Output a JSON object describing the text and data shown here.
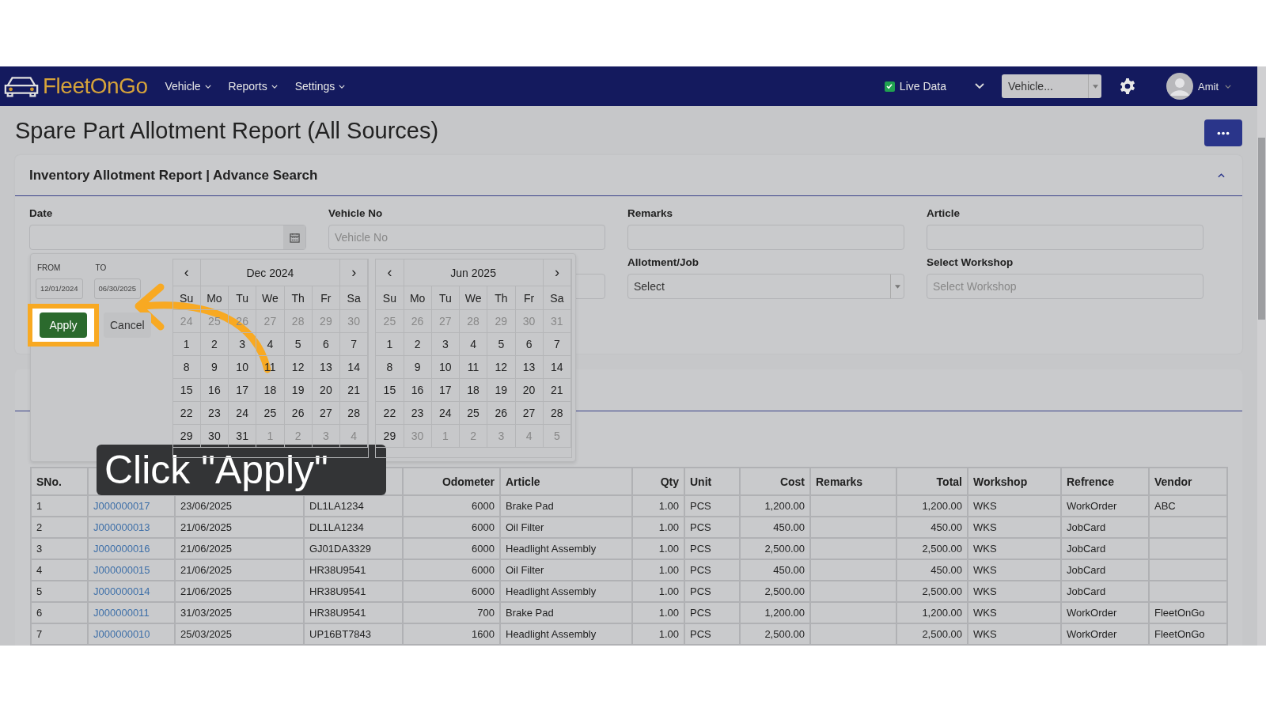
{
  "navbar": {
    "logo": "FleetOnGo",
    "menus": [
      {
        "label": "Vehicle"
      },
      {
        "label": "Reports"
      },
      {
        "label": "Settings"
      }
    ],
    "live_data": {
      "label": "Live Data",
      "checked": true
    },
    "vehicle_select": {
      "value": "Vehicle..."
    },
    "user": {
      "name": "Amit"
    }
  },
  "page_title": "Spare Part Allotment Report (All Sources)",
  "search_panel": {
    "title": "Inventory Allotment Report | Advance Search",
    "expanded": true,
    "fields": [
      {
        "label": "Date",
        "kind": "date"
      },
      {
        "label": "Vehicle No",
        "kind": "text",
        "placeholder": "Vehicle No"
      },
      {
        "label": "Remarks",
        "kind": "text"
      },
      {
        "label": "Article",
        "kind": "text"
      },
      {
        "label": "Allotment/Job",
        "kind": "select",
        "value": "Select"
      },
      {
        "label": "Select Workshop",
        "kind": "text",
        "placeholder": "Select Workshop"
      }
    ]
  },
  "date_picker": {
    "from_label": "FROM",
    "from_value": "12/01/2024",
    "to_label": "TO",
    "to_value": "06/30/2025",
    "apply": "Apply",
    "cancel": "Cancel",
    "calendars": [
      {
        "prev": "‹",
        "next": "›",
        "month": "Dec 2024",
        "weekdays": [
          "Su",
          "Mo",
          "Tu",
          "We",
          "Th",
          "Fr",
          "Sa"
        ],
        "leading_days": [
          "24",
          "25",
          "26",
          "27",
          "28",
          "29",
          "30"
        ],
        "days": [
          "1",
          "2",
          "3",
          "4",
          "5",
          "6",
          "7",
          "8",
          "9",
          "10",
          "11",
          "12",
          "13",
          "14",
          "15",
          "16",
          "17",
          "18",
          "19",
          "20",
          "21",
          "22",
          "23",
          "24",
          "25",
          "26",
          "27",
          "28",
          "29",
          "30",
          "31"
        ],
        "trailing_days": [
          "1",
          "2",
          "3",
          "4"
        ]
      },
      {
        "prev": "‹",
        "next": "›",
        "month": "Jun 2025",
        "weekdays": [
          "Su",
          "Mo",
          "Tu",
          "We",
          "Th",
          "Fr",
          "Sa"
        ],
        "leading_days": [
          "25",
          "26",
          "27",
          "28",
          "29",
          "30",
          "31"
        ],
        "days": [
          "1",
          "2",
          "3",
          "4",
          "5",
          "6",
          "7",
          "8",
          "9",
          "10",
          "11",
          "12",
          "13",
          "14",
          "15",
          "16",
          "17",
          "18",
          "19",
          "20",
          "21",
          "22",
          "23",
          "24",
          "25",
          "26",
          "27",
          "28",
          "29"
        ],
        "trailing_days": [
          "30",
          "1",
          "2",
          "3",
          "4",
          "5"
        ]
      }
    ]
  },
  "tooltip": "Click \"Apply\"",
  "table": {
    "columns": [
      {
        "label": "SNo."
      },
      {},
      {},
      {},
      {
        "label": "Odometer"
      },
      {
        "label": "Article"
      },
      {
        "label": "Qty"
      },
      {
        "label": "Unit"
      },
      {
        "label": "Cost"
      },
      {
        "label": "Remarks"
      },
      {
        "label": "Total"
      },
      {
        "label": "Workshop"
      },
      {
        "label": "Refrence"
      },
      {
        "label": "Vendor"
      }
    ],
    "rows": [
      [
        "1",
        "J000000017",
        "23/06/2025",
        "DL1LA1234",
        "6000",
        "Brake Pad",
        "1.00",
        "PCS",
        "1,200.00",
        "",
        "1,200.00",
        "WKS",
        "WorkOrder",
        "ABC"
      ],
      [
        "2",
        "J000000013",
        "21/06/2025",
        "DL1LA1234",
        "6000",
        "Oil Filter",
        "1.00",
        "PCS",
        "450.00",
        "",
        "450.00",
        "WKS",
        "JobCard",
        ""
      ],
      [
        "3",
        "J000000016",
        "21/06/2025",
        "GJ01DA3329",
        "6000",
        "Headlight Assembly",
        "1.00",
        "PCS",
        "2,500.00",
        "",
        "2,500.00",
        "WKS",
        "JobCard",
        ""
      ],
      [
        "4",
        "J000000015",
        "21/06/2025",
        "HR38U9541",
        "6000",
        "Oil Filter",
        "1.00",
        "PCS",
        "450.00",
        "",
        "450.00",
        "WKS",
        "JobCard",
        ""
      ],
      [
        "5",
        "J000000014",
        "21/06/2025",
        "HR38U9541",
        "6000",
        "Headlight Assembly",
        "1.00",
        "PCS",
        "2,500.00",
        "",
        "2,500.00",
        "WKS",
        "JobCard",
        ""
      ],
      [
        "6",
        "J000000011",
        "31/03/2025",
        "HR38U9541",
        "700",
        "Brake Pad",
        "1.00",
        "PCS",
        "1,200.00",
        "",
        "1,200.00",
        "WKS",
        "WorkOrder",
        "FleetOnGo"
      ],
      [
        "7",
        "J000000010",
        "25/03/2025",
        "UP16BT7843",
        "1600",
        "Headlight Assembly",
        "1.00",
        "PCS",
        "2,500.00",
        "",
        "2,500.00",
        "WKS",
        "WorkOrder",
        "FleetOnGo"
      ]
    ]
  }
}
